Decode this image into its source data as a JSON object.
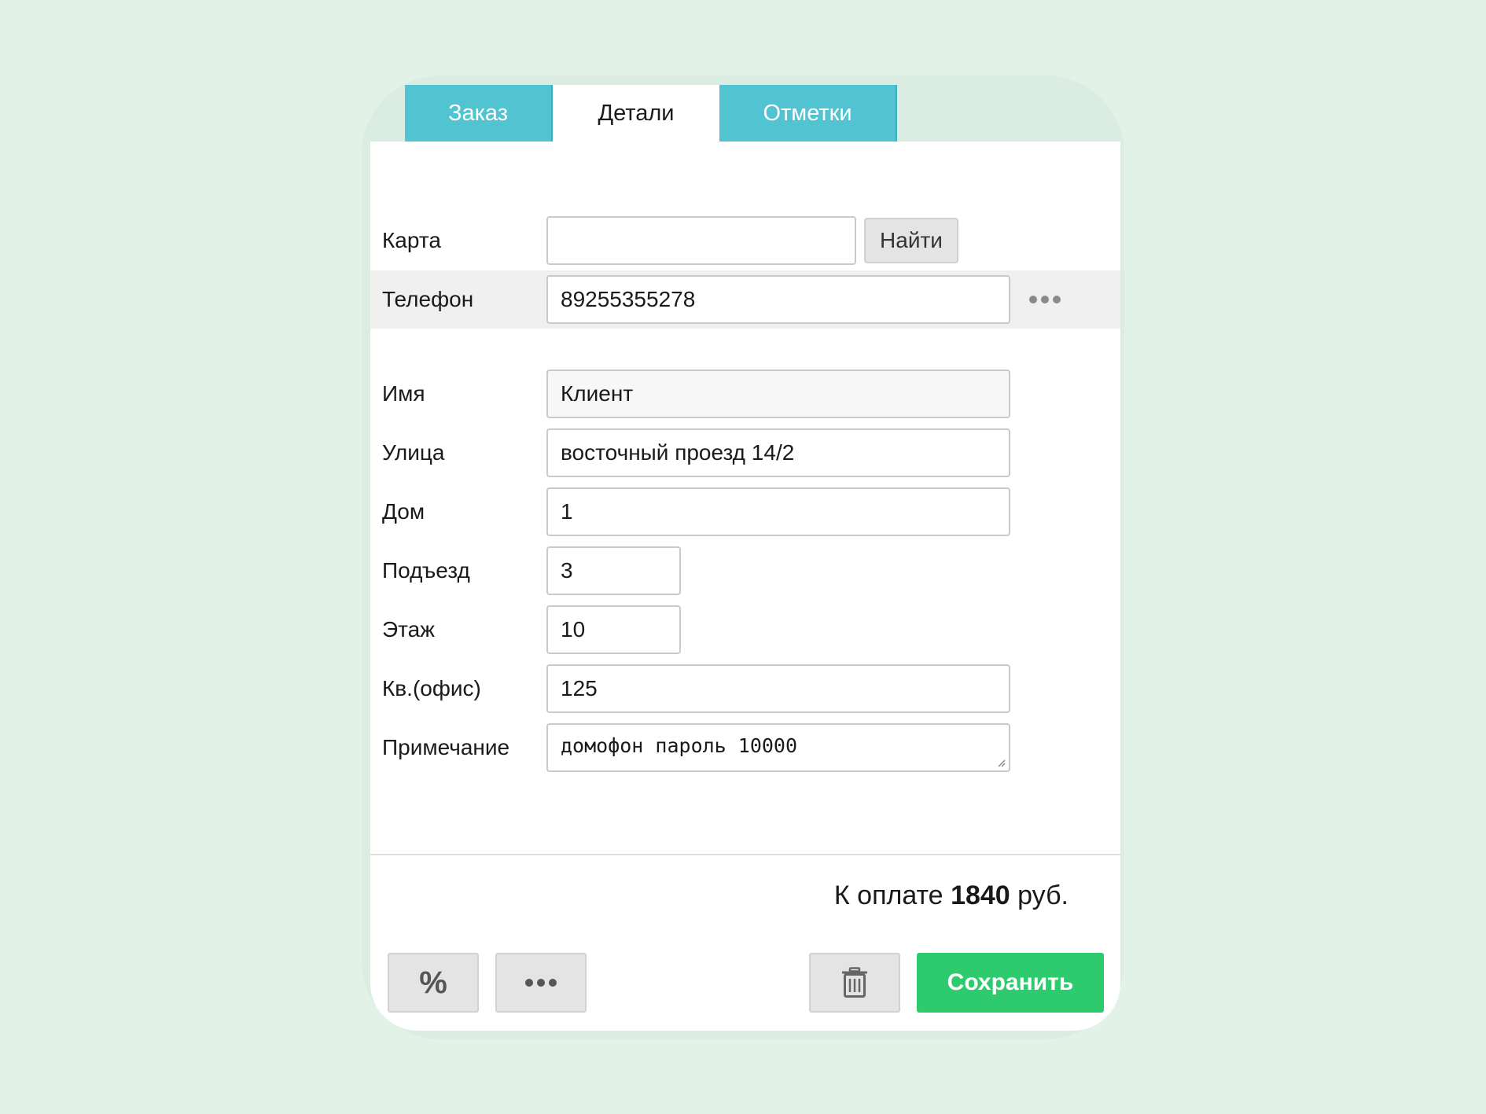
{
  "tabs": [
    {
      "label": "Заказ",
      "active": false
    },
    {
      "label": "Детали",
      "active": true
    },
    {
      "label": "Отметки",
      "active": false
    }
  ],
  "form": {
    "card": {
      "label": "Карта",
      "value": "",
      "find_label": "Найти"
    },
    "phone": {
      "label": "Телефон",
      "value": "89255355278"
    },
    "name": {
      "label": "Имя",
      "value": "Клиент"
    },
    "street": {
      "label": "Улица",
      "value": "восточный проезд 14/2"
    },
    "house": {
      "label": "Дом",
      "value": "1"
    },
    "entrance": {
      "label": "Подъезд",
      "value": "3"
    },
    "floor": {
      "label": "Этаж",
      "value": "10"
    },
    "apartment": {
      "label": "Кв.(офис)",
      "value": "125"
    },
    "note": {
      "label": "Примечание",
      "value": "домофон пароль 10000"
    }
  },
  "total": {
    "prefix": "К оплате",
    "amount": "1840",
    "currency": "руб."
  },
  "actions": {
    "percent_label": "%",
    "save_label": "Сохранить"
  },
  "colors": {
    "background": "#e2f2e6",
    "tab_inactive": "#52c3d1",
    "save": "#2ecb6e"
  }
}
